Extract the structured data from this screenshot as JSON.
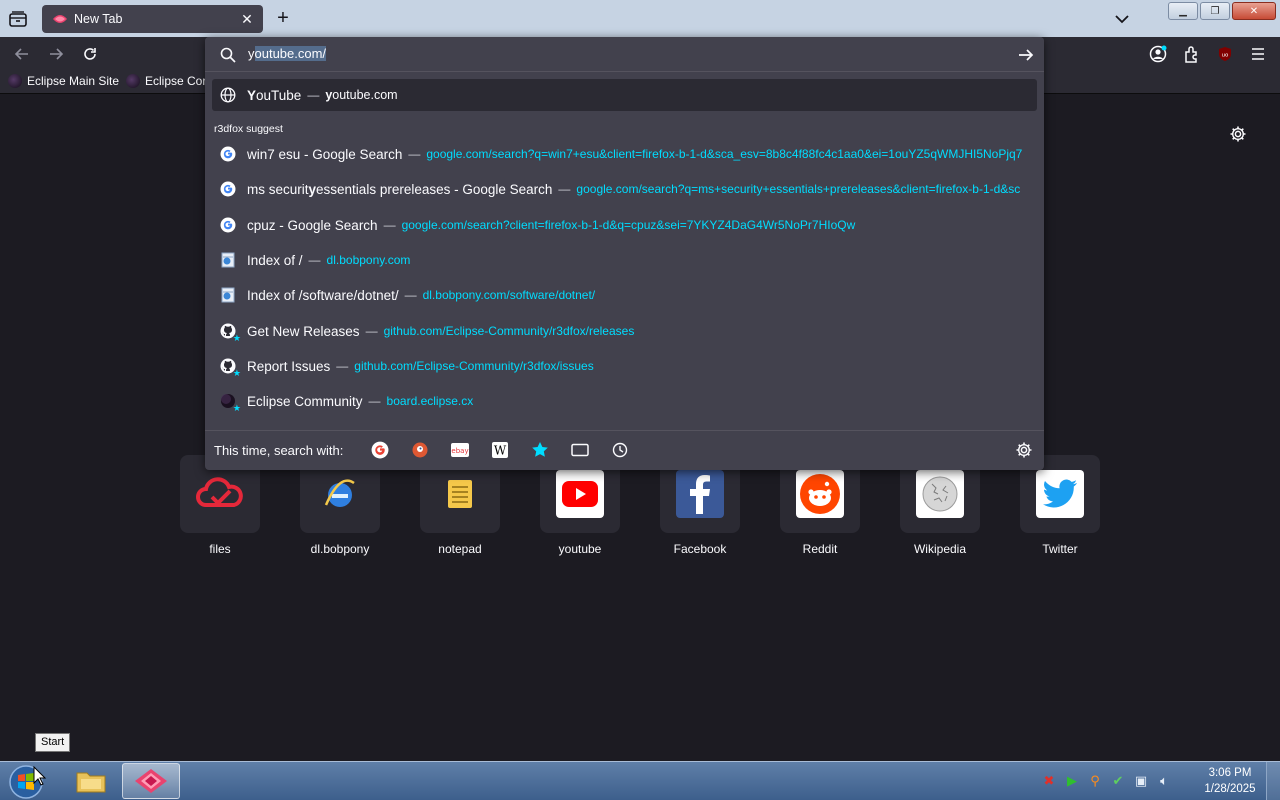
{
  "browser": {
    "tab_title": "New Tab",
    "new_tab_symbol": "+",
    "close_symbol": "✕"
  },
  "bookmarks": [
    {
      "label": "Eclipse Main Site"
    },
    {
      "label": "Eclipse Cor"
    }
  ],
  "urlbar": {
    "typed_prefix": "y",
    "autofill_selected": "outube.com/",
    "heuristic": {
      "title_bold": "Y",
      "title_rest": "ouTube",
      "url_bold": "y",
      "url_rest": "outube.com"
    },
    "group_label": "r3dfox suggest",
    "results": [
      {
        "title": "win7 esu - Google Search",
        "url": "google.com/search?q=win7+esu&client=firefox-b-1-d&sca_esv=8b8c4f88fc4c1aa0&ei=1ouYZ5qWMJHI5NoPjq7",
        "icon": "google-icon"
      },
      {
        "title_pre": "ms securit",
        "title_bold": "y",
        "title_post": " essentials prereleases - Google Search",
        "url": "google.com/search?q=ms+security+essentials+prereleases&client=firefox-b-1-d&sc",
        "icon": "google-icon"
      },
      {
        "title": "cpuz - Google Search",
        "url": "google.com/search?client=firefox-b-1-d&q=cpuz&sei=7YKYZ4DaG4Wr5NoPr7HIoQw",
        "icon": "google-icon"
      },
      {
        "title": "Index of /",
        "url": "dl.bobpony.com",
        "icon": "ie-page-icon"
      },
      {
        "title": "Index of /software/dotnet/",
        "url": "dl.bobpony.com/software/dotnet/",
        "icon": "ie-page-icon"
      },
      {
        "title": "Get New Releases",
        "url": "github.com/Eclipse-Community/r3dfox/releases",
        "icon": "github-icon"
      },
      {
        "title": "Report Issues",
        "url": "github.com/Eclipse-Community/r3dfox/issues",
        "icon": "github-icon"
      },
      {
        "title": "Eclipse Community",
        "url": "board.eclipse.cx",
        "icon": "eclipse-icon"
      }
    ],
    "separator": "—",
    "search_with_label": "This time, search with:"
  },
  "shortcuts": [
    {
      "label": "files",
      "icon": "cloud-icon"
    },
    {
      "label": "dl.bobpony",
      "icon": "ie-icon"
    },
    {
      "label": "notepad",
      "icon": "notepad-icon"
    },
    {
      "label": "youtube",
      "icon": "youtube-icon"
    },
    {
      "label": "Facebook",
      "icon": "facebook-icon"
    },
    {
      "label": "Reddit",
      "icon": "reddit-icon"
    },
    {
      "label": "Wikipedia",
      "icon": "wikipedia-icon"
    },
    {
      "label": "Twitter",
      "icon": "twitter-icon"
    }
  ],
  "taskbar": {
    "start_tooltip": "Start",
    "time": "3:06 PM",
    "date": "1/28/2025"
  },
  "colors": {
    "accent_link": "#00ddff",
    "panel": "#42414d",
    "background": "#1c1b22"
  }
}
